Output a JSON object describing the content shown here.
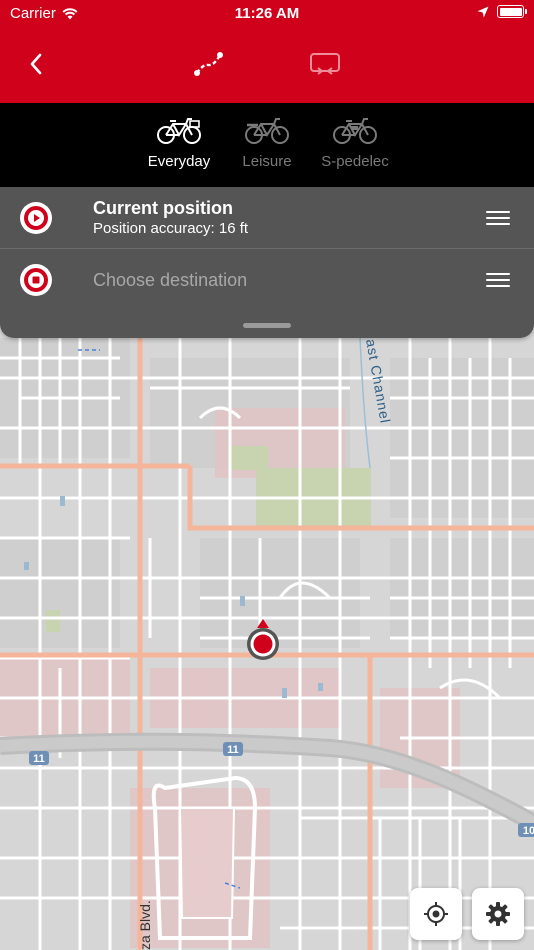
{
  "status_bar": {
    "carrier": "Carrier",
    "time": "11:26 AM"
  },
  "header": {
    "back_icon": "chevron-left-icon",
    "route_icon": "route-icon",
    "reverse_icon": "reverse-route-icon",
    "background_color": "#d0021b"
  },
  "bike_types": [
    {
      "label": "Everyday",
      "icon": "bicycle-basket-icon",
      "selected": true
    },
    {
      "label": "Leisure",
      "icon": "bicycle-rack-icon",
      "selected": false
    },
    {
      "label": "S-pedelec",
      "icon": "e-bicycle-icon",
      "selected": false
    }
  ],
  "route": {
    "start": {
      "title": "Current position",
      "subtitle": "Position accuracy: 16 ft"
    },
    "destination": {
      "placeholder": "Choose destination"
    }
  },
  "map": {
    "labels": {
      "channel": "ast Channel",
      "street": "za Blvd.",
      "hwy_shield_1": "11",
      "hwy_shield_2": "11",
      "hwy_shield_3": "10"
    }
  },
  "map_controls": {
    "locate_icon": "crosshair-icon",
    "settings_icon": "gear-icon"
  }
}
